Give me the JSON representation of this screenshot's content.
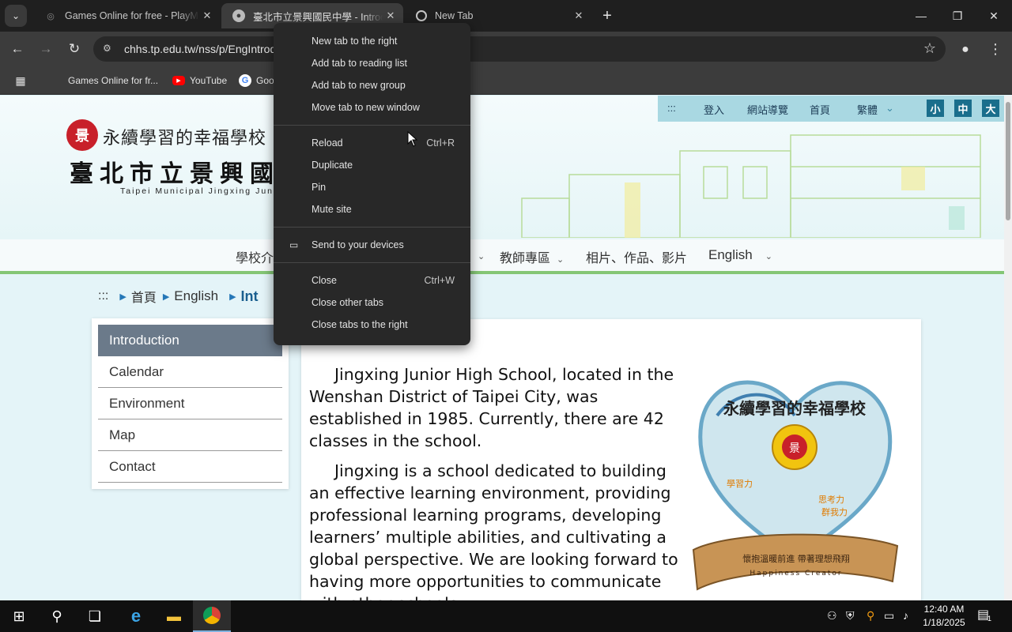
{
  "tabs": [
    {
      "title": "Games Online for free - PlayMin",
      "close": "✕"
    },
    {
      "title": "臺北市立景興國民中學 - Introduction",
      "close": "✕"
    },
    {
      "title": "New Tab",
      "close": "✕"
    }
  ],
  "toolbar": {
    "url": "chhs.tp.edu.tw/nss/p/EngIntroduction"
  },
  "bookmarks": [
    {
      "label": "Games Online for fr..."
    },
    {
      "label": "YouTube"
    },
    {
      "label": "Goo"
    }
  ],
  "site": {
    "topnav": {
      "sep": ":::",
      "login": "登入",
      "sitemap": "網站導覽",
      "home": "首頁",
      "lang": "繁體",
      "size_small": "小",
      "size_mid": "中",
      "size_large": "大"
    },
    "logo": {
      "top": "永續學習的幸福學校",
      "main": "臺北市立景興國",
      "en": "Taipei Municipal Jingxing Jun",
      "seal": "景"
    },
    "mainnav": [
      {
        "label": "學校介"
      },
      {
        "label": "教師專區"
      },
      {
        "label": "相片、作品、影片"
      },
      {
        "label": "English"
      }
    ],
    "breadcrumb": {
      "sep": ":::",
      "home": "首頁",
      "english": "English",
      "current": "Int"
    },
    "sidebar": [
      "Introduction",
      "Calendar",
      "Environment",
      "Map",
      "Contact"
    ],
    "paragraphs": [
      "Jingxing Junior High School, located in the Wenshan District of Taipei City, was established in 1985. Currently, there are 42 classes in the school.",
      "Jingxing is a school dedicated to building an effective learning environment, providing professional learning programs, developing learners’ multiple abilities, and cultivating a global perspective. We are looking forward to having more opportunities to communicate with other schools."
    ],
    "emblem": {
      "ring_text": "永續學習的幸福學校",
      "banner": "懷抱溫暖前進 帶著理想飛翔",
      "banner_en": "Happiness Creator",
      "left_badge": "學習力",
      "right_badge_1": "思考力",
      "right_badge_2": "群我力"
    }
  },
  "context_menu": {
    "items": [
      {
        "label": "New tab to the right",
        "shortcut": ""
      },
      {
        "label": "Add tab to reading list",
        "shortcut": ""
      },
      {
        "label": "Add tab to new group",
        "shortcut": ""
      },
      {
        "label": "Move tab to new window",
        "shortcut": ""
      },
      {
        "label": "Reload",
        "shortcut": "Ctrl+R"
      },
      {
        "label": "Duplicate",
        "shortcut": ""
      },
      {
        "label": "Pin",
        "shortcut": ""
      },
      {
        "label": "Mute site",
        "shortcut": ""
      },
      {
        "label": "Send to your devices",
        "shortcut": ""
      },
      {
        "label": "Close",
        "shortcut": "Ctrl+W"
      },
      {
        "label": "Close other tabs",
        "shortcut": ""
      },
      {
        "label": "Close tabs to the right",
        "shortcut": ""
      }
    ]
  },
  "taskbar": {
    "time": "12:40 AM",
    "date": "1/18/2025",
    "notifications": "1"
  },
  "colors": {
    "accent": "#1a6e8c",
    "nav_underline": "#84c675",
    "menu_bg": "#282828"
  }
}
